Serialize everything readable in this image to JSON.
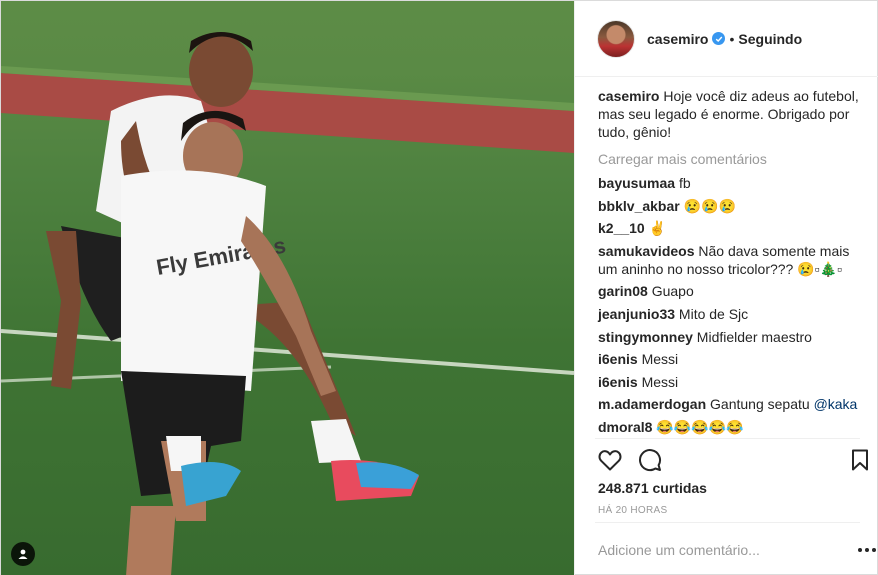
{
  "post": {
    "username": "casemiro",
    "separator": "•",
    "follow_status": "Seguindo",
    "caption_user": "casemiro",
    "caption_text": "Hoje você diz adeus ao futebol, mas seu legado é enorme. Obrigado por tudo, gênio!",
    "load_more": "Carregar mais comentários",
    "photo_sponsor_text": "Fly Emirates",
    "comments": [
      {
        "user": "bayusumaa",
        "text": "fb"
      },
      {
        "user": "bbklv_akbar",
        "text": "😢😢😢"
      },
      {
        "user": "k2__10",
        "text": "✌"
      },
      {
        "user": "samukavideos",
        "text": "Não dava somente mais um aninho no nosso tricolor??? 😢▫🎄▫"
      },
      {
        "user": "garin08",
        "text": "Guapo"
      },
      {
        "user": "jeanjunio33",
        "text": "Mito de Sjc"
      },
      {
        "user": "stingymonney",
        "text": "Midfielder maestro"
      },
      {
        "user": "i6enis",
        "text": "Messi"
      },
      {
        "user": "i6enis",
        "text": "Messi"
      },
      {
        "user": "m.adamerdogan",
        "text": "Gantung sepatu",
        "mention": "@kaka"
      },
      {
        "user": "dmoral8",
        "text": "😂😂😂😂😂"
      }
    ],
    "likes": "248.871 curtidas",
    "time_ago": "HÁ 20 HORAS",
    "comment_placeholder": "Adicione um comentário...",
    "icons": {
      "verified": "verified-badge-icon",
      "like": "heart-icon",
      "comment": "comment-bubble-icon",
      "save": "bookmark-icon",
      "more": "more-options-icon",
      "tag": "user-tag-icon"
    },
    "colors": {
      "text": "#262626",
      "muted": "#999999",
      "verified": "#3897f0",
      "mention": "#003569",
      "border": "#efefef"
    }
  }
}
